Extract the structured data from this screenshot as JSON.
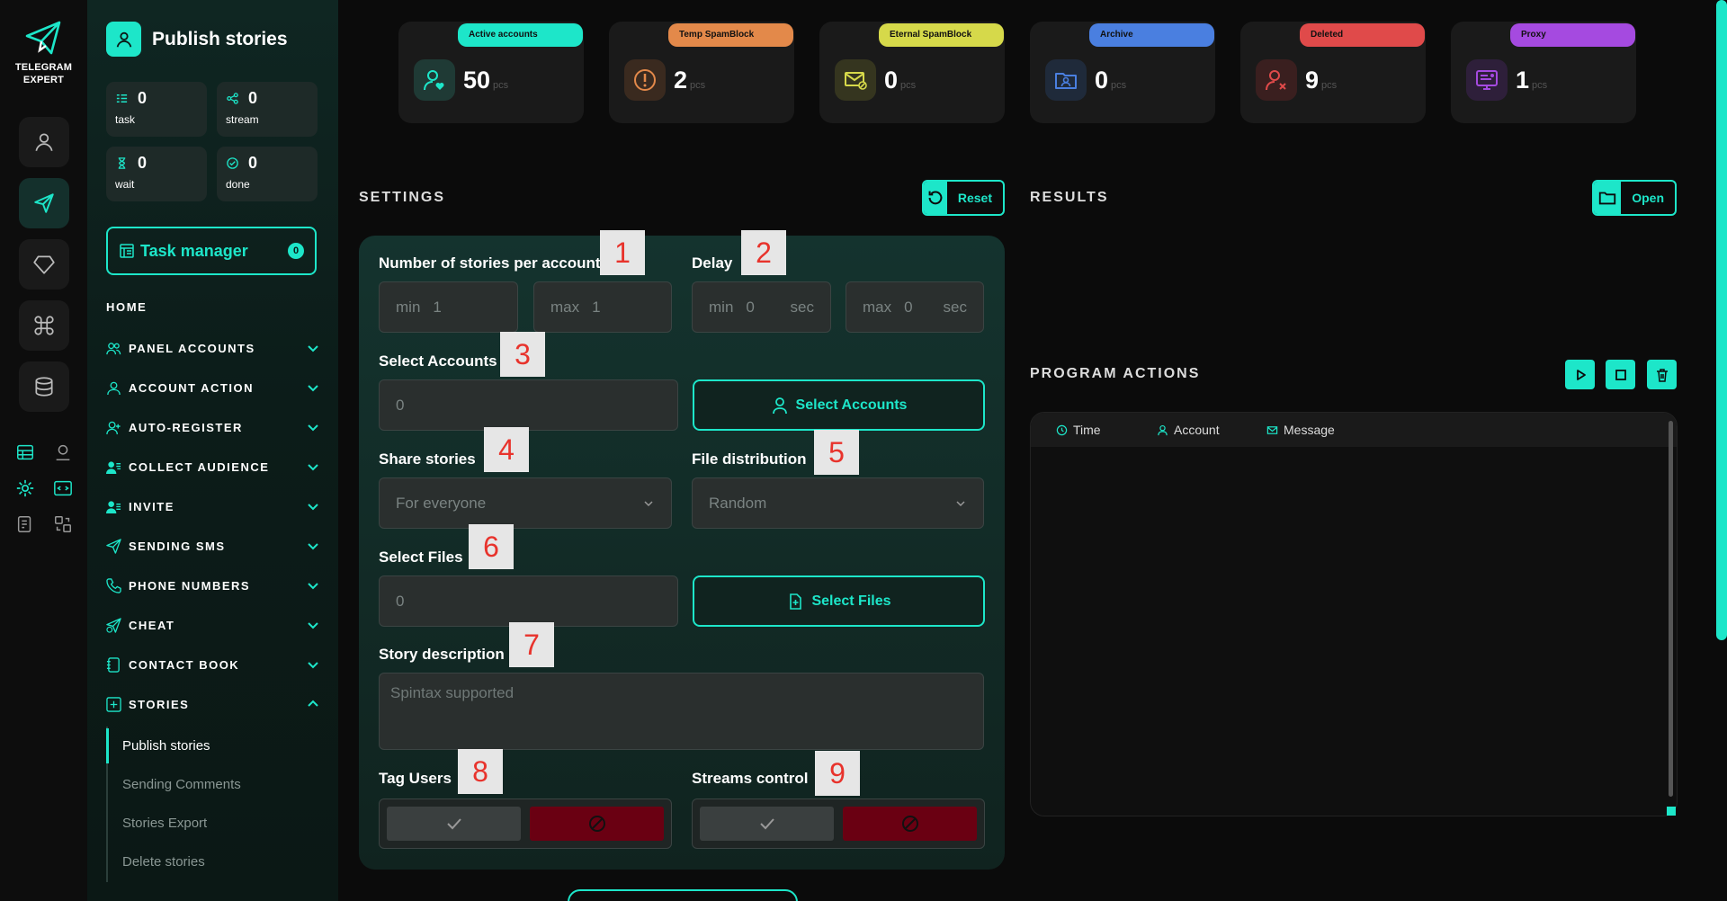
{
  "brand": {
    "name_line1": "TELEGRAM",
    "name_line2": "EXPERT"
  },
  "page": {
    "title": "Publish stories"
  },
  "stats": [
    {
      "value": "0",
      "label": "task"
    },
    {
      "value": "0",
      "label": "stream"
    },
    {
      "value": "0",
      "label": "wait"
    },
    {
      "value": "0",
      "label": "done"
    }
  ],
  "task_manager": {
    "label": "Task manager",
    "count": "0"
  },
  "nav": {
    "home": "HOME",
    "items": [
      {
        "label": "PANEL ACCOUNTS",
        "icon": "users-icon"
      },
      {
        "label": "ACCOUNT ACTION",
        "icon": "user-icon"
      },
      {
        "label": "AUTO-REGISTER",
        "icon": "user-plus-icon"
      },
      {
        "label": "COLLECT AUDIENCE",
        "icon": "audience-icon"
      },
      {
        "label": "INVITE",
        "icon": "invite-icon"
      },
      {
        "label": "SENDING SMS",
        "icon": "send-icon"
      },
      {
        "label": "PHONE NUMBERS",
        "icon": "phone-icon"
      },
      {
        "label": "CHEAT",
        "icon": "cheat-icon"
      },
      {
        "label": "CONTACT BOOK",
        "icon": "contact-book-icon"
      },
      {
        "label": "STORIES",
        "icon": "stories-icon"
      }
    ],
    "sub_items": [
      "Publish stories",
      "Sending Comments",
      "Stories Export",
      "Delete stories"
    ]
  },
  "cards": [
    {
      "label": "Active accounts",
      "value": "50",
      "unit": "pcs",
      "color": "#1de6c9"
    },
    {
      "label": "Temp SpamBlock",
      "value": "2",
      "unit": "pcs",
      "color": "#e3894a"
    },
    {
      "label": "Eternal SpamBlock",
      "value": "0",
      "unit": "pcs",
      "color": "#d6d94a"
    },
    {
      "label": "Archive",
      "value": "0",
      "unit": "pcs",
      "color": "#4a7fe0"
    },
    {
      "label": "Deleted",
      "value": "9",
      "unit": "pcs",
      "color": "#e04a4a"
    },
    {
      "label": "Proxy",
      "value": "1",
      "unit": "pcs",
      "color": "#a54ae0"
    }
  ],
  "settings": {
    "title": "SETTINGS",
    "reset": "Reset",
    "stories_label": "Number of stories per account",
    "stories_min_pre": "min",
    "stories_min": "1",
    "stories_max_pre": "max",
    "stories_max": "1",
    "delay_label": "Delay",
    "delay_min_pre": "min",
    "delay_min": "0",
    "delay_min_suf": "sec",
    "delay_max_pre": "max",
    "delay_max": "0",
    "delay_max_suf": "sec",
    "accounts_label": "Select Accounts",
    "accounts_value": "0",
    "accounts_button": "Select Accounts",
    "share_label": "Share stories",
    "share_value": "For everyone",
    "distribution_label": "File distribution",
    "distribution_value": "Random",
    "files_label": "Select Files",
    "files_value": "0",
    "files_button": "Select Files",
    "description_label": "Story description",
    "description_placeholder": "Spintax supported",
    "tag_label": "Tag Users",
    "streams_label": "Streams control"
  },
  "markers": [
    "1",
    "2",
    "3",
    "4",
    "5",
    "6",
    "7",
    "8",
    "9"
  ],
  "results": {
    "title": "RESULTS",
    "open": "Open"
  },
  "actions": {
    "title": "PROGRAM ACTIONS",
    "columns": [
      "Time",
      "Account",
      "Message"
    ]
  },
  "colors": {
    "accent": "#1de6c9",
    "off": "#6a0012"
  }
}
